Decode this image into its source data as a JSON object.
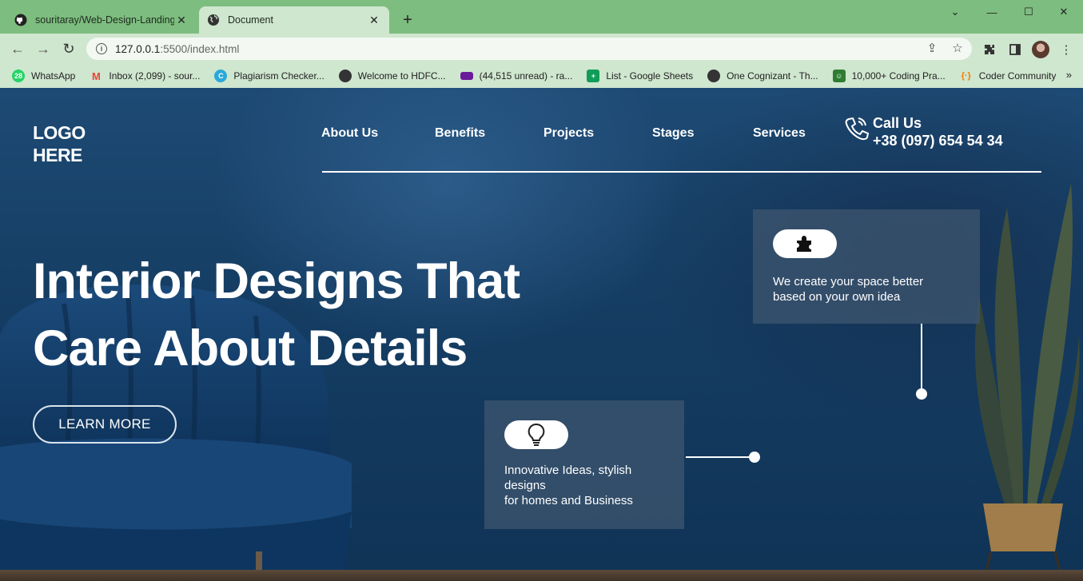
{
  "browser": {
    "tabs": [
      {
        "title": "souritaray/Web-Design-Landing-",
        "active": false,
        "favicon": "github-icon"
      },
      {
        "title": "Document",
        "active": true,
        "favicon": "globe-icon"
      }
    ],
    "url": {
      "host": "127.0.0.1",
      "rest": ":5500/index.html"
    },
    "bookmarks": [
      {
        "label": "WhatsApp",
        "icon": "whatsapp-icon",
        "badge": "28",
        "color": "#25d366"
      },
      {
        "label": "Inbox (2,099) - sour...",
        "icon": "gmail-icon",
        "color": "#ea4335"
      },
      {
        "label": "Plagiarism Checker...",
        "icon": "plagiarism-icon",
        "color": "#2aa8d8"
      },
      {
        "label": "Welcome to HDFC...",
        "icon": "globe-icon",
        "color": "#333333"
      },
      {
        "label": "(44,515 unread) - ra...",
        "icon": "mail-icon",
        "color": "#6a1b9a"
      },
      {
        "label": "List - Google Sheets",
        "icon": "sheets-icon",
        "color": "#0f9d58"
      },
      {
        "label": "One Cognizant - Th...",
        "icon": "globe-icon",
        "color": "#333333"
      },
      {
        "label": "10,000+ Coding Pra...",
        "icon": "coding-icon",
        "color": "#2e7d32"
      },
      {
        "label": "Coder Community",
        "icon": "code-icon",
        "color": "#f57c00"
      }
    ]
  },
  "site": {
    "logo": {
      "line1": "LOGO",
      "line2": "HERE"
    },
    "nav": [
      "About Us",
      "Benefits",
      "Projects",
      "Stages",
      "Services"
    ],
    "call": {
      "label": "Call Us",
      "number": "+38 (097) 654 54 34"
    },
    "hero": {
      "line1": "Interior Designs That",
      "line2": "Care About Details",
      "button": "LEARN MORE"
    },
    "cards": [
      {
        "icon": "puzzle-icon",
        "lines": [
          "We create your space better",
          "based on your own idea"
        ]
      },
      {
        "icon": "lightbulb-icon",
        "lines": [
          "Innovative Ideas, stylish",
          "designs",
          "for homes and Business"
        ]
      }
    ]
  }
}
